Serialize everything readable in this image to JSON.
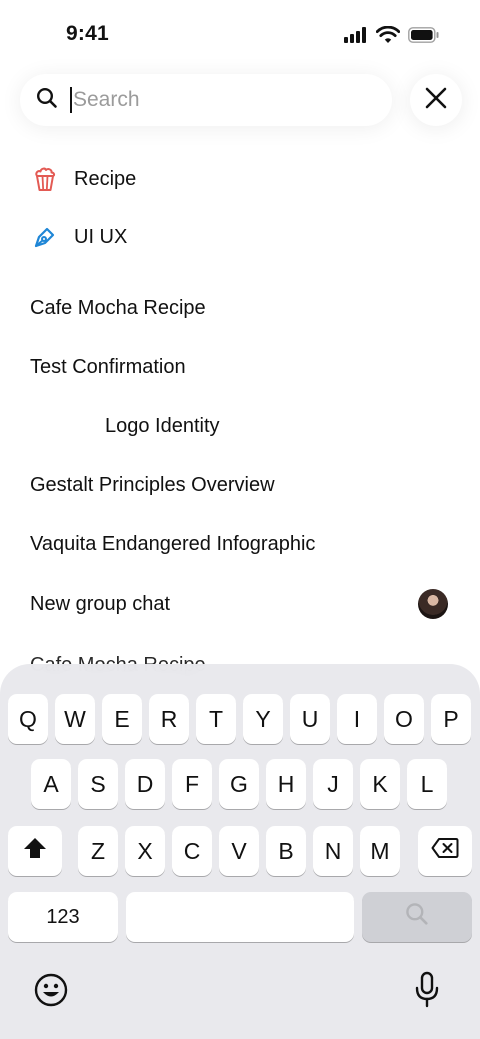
{
  "status": {
    "time": "9:41",
    "icons": [
      "signal-icon",
      "wifi-icon",
      "battery-icon"
    ]
  },
  "search": {
    "placeholder": "Search",
    "value": "",
    "search_icon": "magnifier-icon",
    "close_icon": "close-icon"
  },
  "categories": [
    {
      "label": "Recipe",
      "icon": "popcorn-icon",
      "color": "#e35a54"
    },
    {
      "label": "UI UX",
      "icon": "pen-tool-icon",
      "color": "#1f86d6"
    }
  ],
  "results": [
    {
      "label": "Cafe Mocha Recipe"
    },
    {
      "label": "Test Confirmation"
    },
    {
      "label": "Logo Identity"
    },
    {
      "label": "Gestalt Principles Overview"
    },
    {
      "label": "Vaquita Endangered Infographic"
    },
    {
      "label": "New group chat",
      "avatar": true
    }
  ],
  "partially_hidden_result": "Cafe Mocha Recipe",
  "keyboard": {
    "row1": [
      "Q",
      "W",
      "E",
      "R",
      "T",
      "Y",
      "U",
      "I",
      "O",
      "P"
    ],
    "row2": [
      "A",
      "S",
      "D",
      "F",
      "G",
      "H",
      "J",
      "K",
      "L"
    ],
    "row3": [
      "Z",
      "X",
      "C",
      "V",
      "B",
      "N",
      "M"
    ],
    "numbers_label": "123",
    "shift_icon": "shift-icon",
    "delete_icon": "backspace-icon",
    "search_key_icon": "magnifier-icon",
    "emoji_icon": "emoji-icon",
    "mic_icon": "microphone-icon"
  }
}
